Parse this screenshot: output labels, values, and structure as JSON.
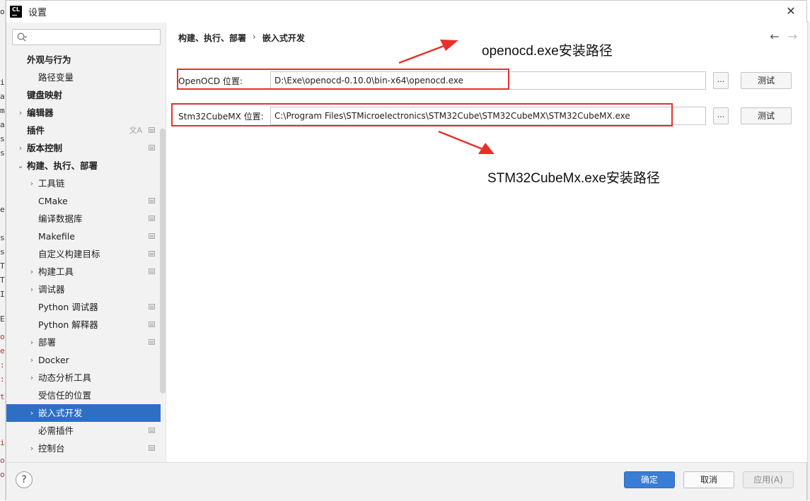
{
  "window": {
    "title": "设置",
    "app_logo": "CL"
  },
  "search": {
    "placeholder": "Q·"
  },
  "sidebar": {
    "items": [
      {
        "label": "外观与行为",
        "level": 0,
        "bold": true,
        "arrow": "",
        "project_icon": false
      },
      {
        "label": "路径变量",
        "level": 1,
        "bold": false,
        "arrow": "",
        "project_icon": false
      },
      {
        "label": "键盘映射",
        "level": 0,
        "bold": true,
        "arrow": "",
        "project_icon": false
      },
      {
        "label": "编辑器",
        "level": 0,
        "bold": true,
        "arrow": "›",
        "project_icon": false
      },
      {
        "label": "插件",
        "level": 0,
        "bold": true,
        "arrow": "",
        "project_icon": true,
        "translate_icon": true
      },
      {
        "label": "版本控制",
        "level": 0,
        "bold": true,
        "arrow": "›",
        "project_icon": true
      },
      {
        "label": "构建、执行、部署",
        "level": 0,
        "bold": true,
        "arrow": "⌄",
        "project_icon": false
      },
      {
        "label": "工具链",
        "level": 1,
        "bold": false,
        "arrow": "›",
        "project_icon": false
      },
      {
        "label": "CMake",
        "level": 1,
        "bold": false,
        "arrow": "",
        "project_icon": true
      },
      {
        "label": "编译数据库",
        "level": 1,
        "bold": false,
        "arrow": "",
        "project_icon": true
      },
      {
        "label": "Makefile",
        "level": 1,
        "bold": false,
        "arrow": "",
        "project_icon": true
      },
      {
        "label": "自定义构建目标",
        "level": 1,
        "bold": false,
        "arrow": "",
        "project_icon": true
      },
      {
        "label": "构建工具",
        "level": 1,
        "bold": false,
        "arrow": "›",
        "project_icon": true
      },
      {
        "label": "调试器",
        "level": 1,
        "bold": false,
        "arrow": "›",
        "project_icon": false
      },
      {
        "label": "Python 调试器",
        "level": 1,
        "bold": false,
        "arrow": "",
        "project_icon": true
      },
      {
        "label": "Python 解释器",
        "level": 1,
        "bold": false,
        "arrow": "",
        "project_icon": true
      },
      {
        "label": "部署",
        "level": 1,
        "bold": false,
        "arrow": "›",
        "project_icon": true
      },
      {
        "label": "Docker",
        "level": 1,
        "bold": false,
        "arrow": "›",
        "project_icon": false
      },
      {
        "label": "动态分析工具",
        "level": 1,
        "bold": false,
        "arrow": "›",
        "project_icon": false
      },
      {
        "label": "受信任的位置",
        "level": 1,
        "bold": false,
        "arrow": "",
        "project_icon": false
      },
      {
        "label": "嵌入式开发",
        "level": 1,
        "bold": false,
        "arrow": "›",
        "project_icon": false,
        "selected": true
      },
      {
        "label": "必需插件",
        "level": 1,
        "bold": false,
        "arrow": "",
        "project_icon": true
      },
      {
        "label": "控制台",
        "level": 1,
        "bold": false,
        "arrow": "›",
        "project_icon": true
      }
    ]
  },
  "breadcrumb": {
    "parent": "构建、执行、部署",
    "separator": "›",
    "current": "嵌入式开发"
  },
  "nav": {
    "back": "←",
    "forward": "→"
  },
  "fields": {
    "openocd": {
      "label": "OpenOCD 位置:",
      "value": "D:\\Exe\\openocd-0.10.0\\bin-x64\\openocd.exe",
      "browse": "...",
      "test": "测试"
    },
    "cubemx": {
      "label": "Stm32CubeMX 位置:",
      "value": "C:\\Program Files\\STMicroelectronics\\STM32Cube\\STM32CubeMX\\STM32CubeMX.exe",
      "browse": "...",
      "test": "测试"
    }
  },
  "annotations": {
    "openocd_note": "openocd.exe安装路径",
    "cubemx_note": "STM32CubeMx.exe安装路径",
    "color": "#e8302b"
  },
  "footer": {
    "help": "?",
    "ok": "确定",
    "cancel": "取消",
    "apply": "应用(A)"
  },
  "colors": {
    "accent": "#2e6fc4",
    "ok_button": "#3a7dd4"
  }
}
